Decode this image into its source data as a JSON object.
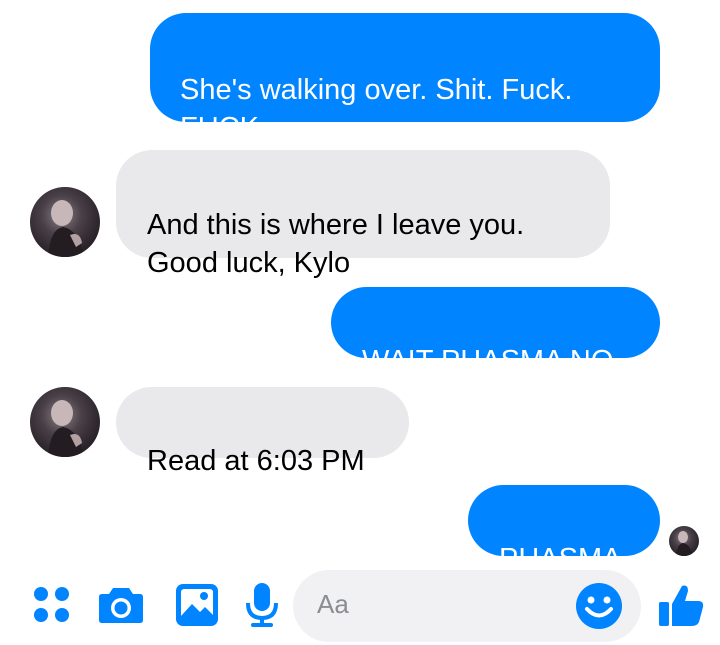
{
  "messages": [
    {
      "direction": "outgoing",
      "text": "She's walking over. Shit. Fuck.\nFUCK"
    },
    {
      "direction": "incoming",
      "text": "And this is where I leave you.\nGood luck, Kylo"
    },
    {
      "direction": "outgoing",
      "text": "WAIT PHASMA NO"
    },
    {
      "direction": "incoming",
      "text": "Read at 6:03 PM"
    },
    {
      "direction": "outgoing",
      "text": "PHASMA"
    }
  ],
  "composer": {
    "placeholder": "Aa",
    "icons": [
      "apps-grid-icon",
      "camera-icon",
      "image-icon",
      "microphone-icon",
      "emoji-icon",
      "thumbs-up-icon"
    ]
  },
  "colors": {
    "accent": "#0084ff",
    "incoming_bubble": "#e9e9eb",
    "input_bg": "#f1f1f3"
  }
}
